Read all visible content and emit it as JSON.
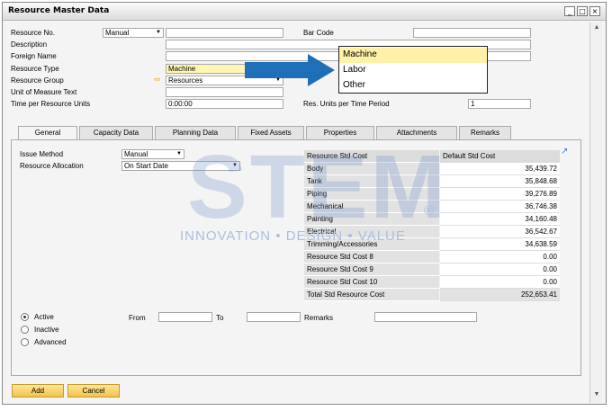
{
  "window": {
    "title": "Resource Master Data",
    "buttons": [
      "_",
      "□",
      "×"
    ]
  },
  "header": {
    "resource_no": {
      "label": "Resource No.",
      "value": "Manual"
    },
    "bar_code": {
      "label": "Bar Code",
      "value": ""
    },
    "description": {
      "label": "Description",
      "value": ""
    },
    "foreign_name": {
      "label": "Foreign Name",
      "value": ""
    },
    "resource_type": {
      "label": "Resource Type",
      "value": "Machine"
    },
    "resource_group": {
      "label": "Resource Group",
      "value": "Resources"
    },
    "uom_text": {
      "label": "Unit of Measure Text",
      "value": ""
    },
    "time_per_unit": {
      "label": "Time per Resource Units",
      "value": "0:00:00"
    },
    "res_units": {
      "label": "Res. Units per Time Period",
      "value": "1"
    }
  },
  "dropdown": {
    "items": [
      "Machine",
      "Labor",
      "Other"
    ],
    "selected": "Machine"
  },
  "tabs": [
    "General",
    "Capacity Data",
    "Planning Data",
    "Fixed Assets",
    "Properties",
    "Attachments",
    "Remarks"
  ],
  "general": {
    "issue_method": {
      "label": "Issue Method",
      "value": "Manual"
    },
    "resource_allocation": {
      "label": "Resource Allocation",
      "value": "On Start Date"
    }
  },
  "cost_table": {
    "headers": [
      "Resource Std Cost",
      "Default Std Cost"
    ],
    "rows": [
      {
        "name": "Body",
        "value": "35,439.72"
      },
      {
        "name": "Tank",
        "value": "35,848.68"
      },
      {
        "name": "Piping",
        "value": "39,276.89"
      },
      {
        "name": "Mechanical",
        "value": "36,746.38"
      },
      {
        "name": "Painting",
        "value": "34,160.48"
      },
      {
        "name": "Electrical",
        "value": "36,542.67"
      },
      {
        "name": "Trimming/Accessories",
        "value": "34,638.59"
      },
      {
        "name": "Resource Std Cost 8",
        "value": "0.00"
      },
      {
        "name": "Resource Std Cost 9",
        "value": "0.00"
      },
      {
        "name": "Resource Std Cost 10",
        "value": "0.00"
      }
    ],
    "total": {
      "name": "Total Std Resource Cost",
      "value": "252,653.41"
    }
  },
  "status": {
    "options": [
      "Active",
      "Inactive",
      "Advanced"
    ],
    "selected": "Active",
    "from_label": "From",
    "to_label": "To",
    "remarks_label": "Remarks"
  },
  "footer": {
    "add_label": "Add",
    "cancel_label": "Cancel"
  },
  "watermark": {
    "brand": "STEM",
    "tagline": "INNOVATION • DESIGN • VALUE",
    "reg": "®"
  },
  "colors": {
    "highlight": "#fff6b3",
    "button": "#f4c24a",
    "arrow": "#1f6fb8"
  }
}
